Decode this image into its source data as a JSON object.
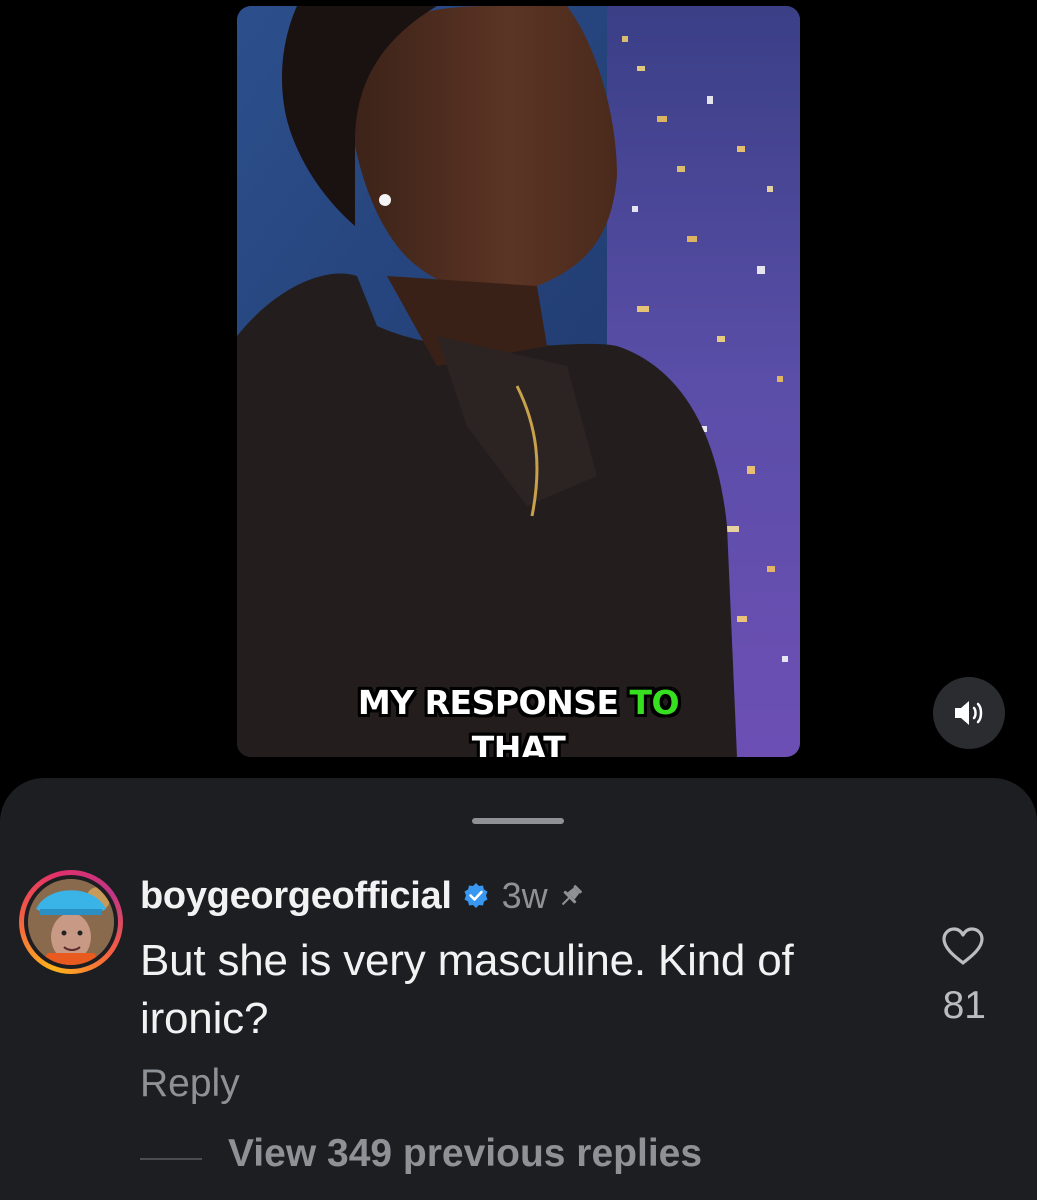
{
  "video": {
    "caption_line1_a": "MY RESPONSE",
    "caption_line1_b": "TO",
    "caption_line2": "THAT",
    "caption_highlight_color": "#36e021",
    "sound_icon": "speaker-on-icon"
  },
  "comment": {
    "username": "boygeorgeofficial",
    "verified": true,
    "verified_color": "#3897f0",
    "time": "3w",
    "pinned": true,
    "text": "But she is very masculine. Kind of ironic?",
    "reply_label": "Reply",
    "like_count": "81",
    "view_replies_label": "View 349 previous replies"
  }
}
